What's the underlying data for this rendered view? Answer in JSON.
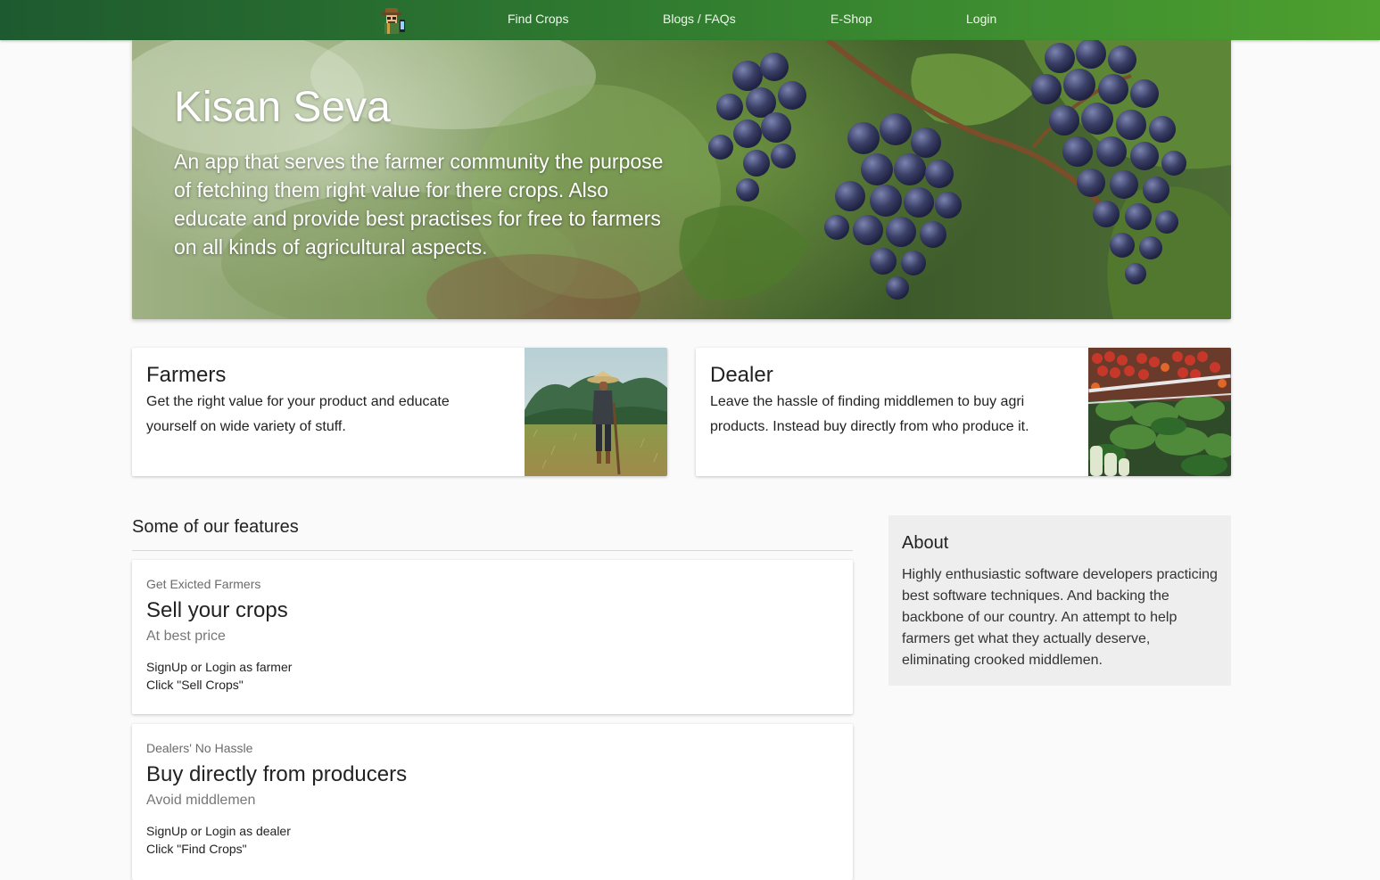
{
  "nav": {
    "logo_icon": "farmer-logo-icon",
    "links": [
      "Find Crops",
      "Blogs / FAQs",
      "E-Shop",
      "Login"
    ]
  },
  "hero": {
    "title": "Kisan Seva",
    "description": "An app that serves the farmer community the purpose of fetching them right value for there crops. Also educate and provide best practises for free to farmers on all kinds of agricultural aspects.",
    "image": "grapes-vineyard-photo"
  },
  "roles": [
    {
      "title": "Farmers",
      "text": "Get the right value for your product and educate yourself on wide variety of stuff.",
      "image": "farmer-in-field-photo"
    },
    {
      "title": "Dealer",
      "text": "Leave the hassle of finding middlemen to buy agri products. Instead buy directly from who produce it.",
      "image": "vegetable-market-photo"
    }
  ],
  "features": {
    "heading": "Some of our features",
    "items": [
      {
        "eyebrow": "Get Exicted Farmers",
        "title": "Sell your crops",
        "subtitle": "At best price",
        "lines": [
          "SignUp or Login as farmer",
          "Click \"Sell Crops\""
        ]
      },
      {
        "eyebrow": "Dealers' No Hassle",
        "title": "Buy directly from producers",
        "subtitle": "Avoid middlemen",
        "lines": [
          "SignUp or Login as dealer",
          "Click \"Find Crops\""
        ]
      }
    ]
  },
  "about": {
    "title": "About",
    "text": "Highly enthusiastic software developers practicing best software techniques. And backing the backbone of our country. An attempt to help farmers get what they actually deserve, eliminating crooked middlemen."
  },
  "colors": {
    "nav_start": "#1e5a2f",
    "nav_end": "#4ea02f",
    "page_bg": "#fafafa",
    "about_bg": "#eeeeee"
  }
}
